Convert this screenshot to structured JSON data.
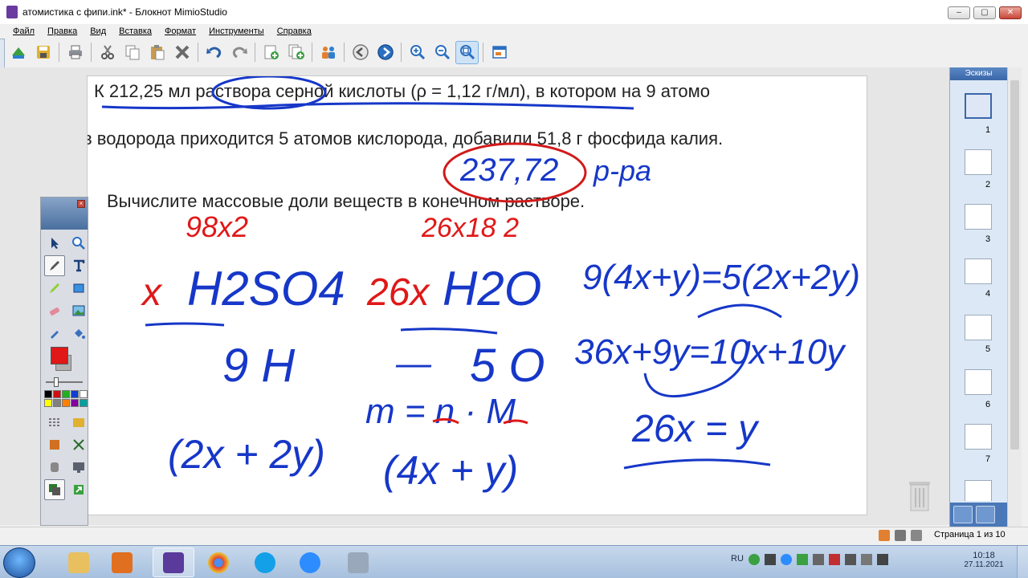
{
  "window": {
    "title": "атомистика с фипи.ink* - Блокнот MimioStudio",
    "buttons": {
      "minimize": "–",
      "maximize": "▢",
      "close": "✕"
    }
  },
  "menu": [
    "Файл",
    "Правка",
    "Вид",
    "Вставка",
    "Формат",
    "Инструменты",
    "Справка"
  ],
  "toolbar": {
    "groups": [
      [
        "open-icon",
        "save-icon"
      ],
      [
        "print-icon"
      ],
      [
        "cut-icon",
        "copy-icon",
        "paste-icon",
        "delete-icon"
      ],
      [
        "undo-icon",
        "redo-icon"
      ],
      [
        "new-page-icon",
        "duplicate-page-icon"
      ],
      [
        "users-icon"
      ],
      [
        "previous-page-icon",
        "next-page-icon"
      ],
      [
        "zoom-in-icon",
        "zoom-out-icon",
        "zoom-fit-icon"
      ],
      [
        "fit-page-icon"
      ]
    ]
  },
  "page": {
    "line1": "К 212,25 мл раствора серной кислоты (ρ = 1,12 г/мл), в котором на 9 атомо",
    "line2": "в водорода приходится 5 атомов кислорода, добавили 51,8 г фосфида калия.",
    "line3": "Вычислите массовые доли веществ в конечном растворе.",
    "handwriting": {
      "circled_mass": "237,72",
      "solution_note": "р-ра",
      "mult_sulfuric": "98x2",
      "mult_water": "26x18 2",
      "sulfuric_coef": "x",
      "water_coef": "26x",
      "sulfuric_acid": "H2SO4",
      "water": "H2O",
      "equation1": "9(4x+y)=5(2x+2y)",
      "hydrogen": "9 H",
      "dash": "—",
      "oxygen": "5 O",
      "equation2": "36x+9y=10x+10y",
      "mass_formula": "m = n · M",
      "h_sum": "(2x + 2y)",
      "o_sum": "(4x + y)",
      "result": "26x = y"
    }
  },
  "thumbnails": {
    "title": "Эскизы",
    "pages": [
      "1",
      "2",
      "3",
      "4",
      "5",
      "6",
      "7"
    ],
    "selected": "1"
  },
  "status": {
    "page_info": "Страница 1 из 10"
  },
  "taskbar": {
    "apps": [
      "explorer",
      "media-player",
      "mimio-studio",
      "chrome",
      "skype",
      "zoom",
      "calculator"
    ],
    "language": "RU",
    "time": "10:18",
    "date": "27.11.2021"
  },
  "palette": {
    "swatches": [
      "#000000",
      "#d01010",
      "#20b020",
      "#1040d0",
      "#ffffff",
      "#ffff00",
      "#808080",
      "#ff8000",
      "#8000a0",
      "#00a0a0"
    ],
    "current_color": "#d01010"
  }
}
